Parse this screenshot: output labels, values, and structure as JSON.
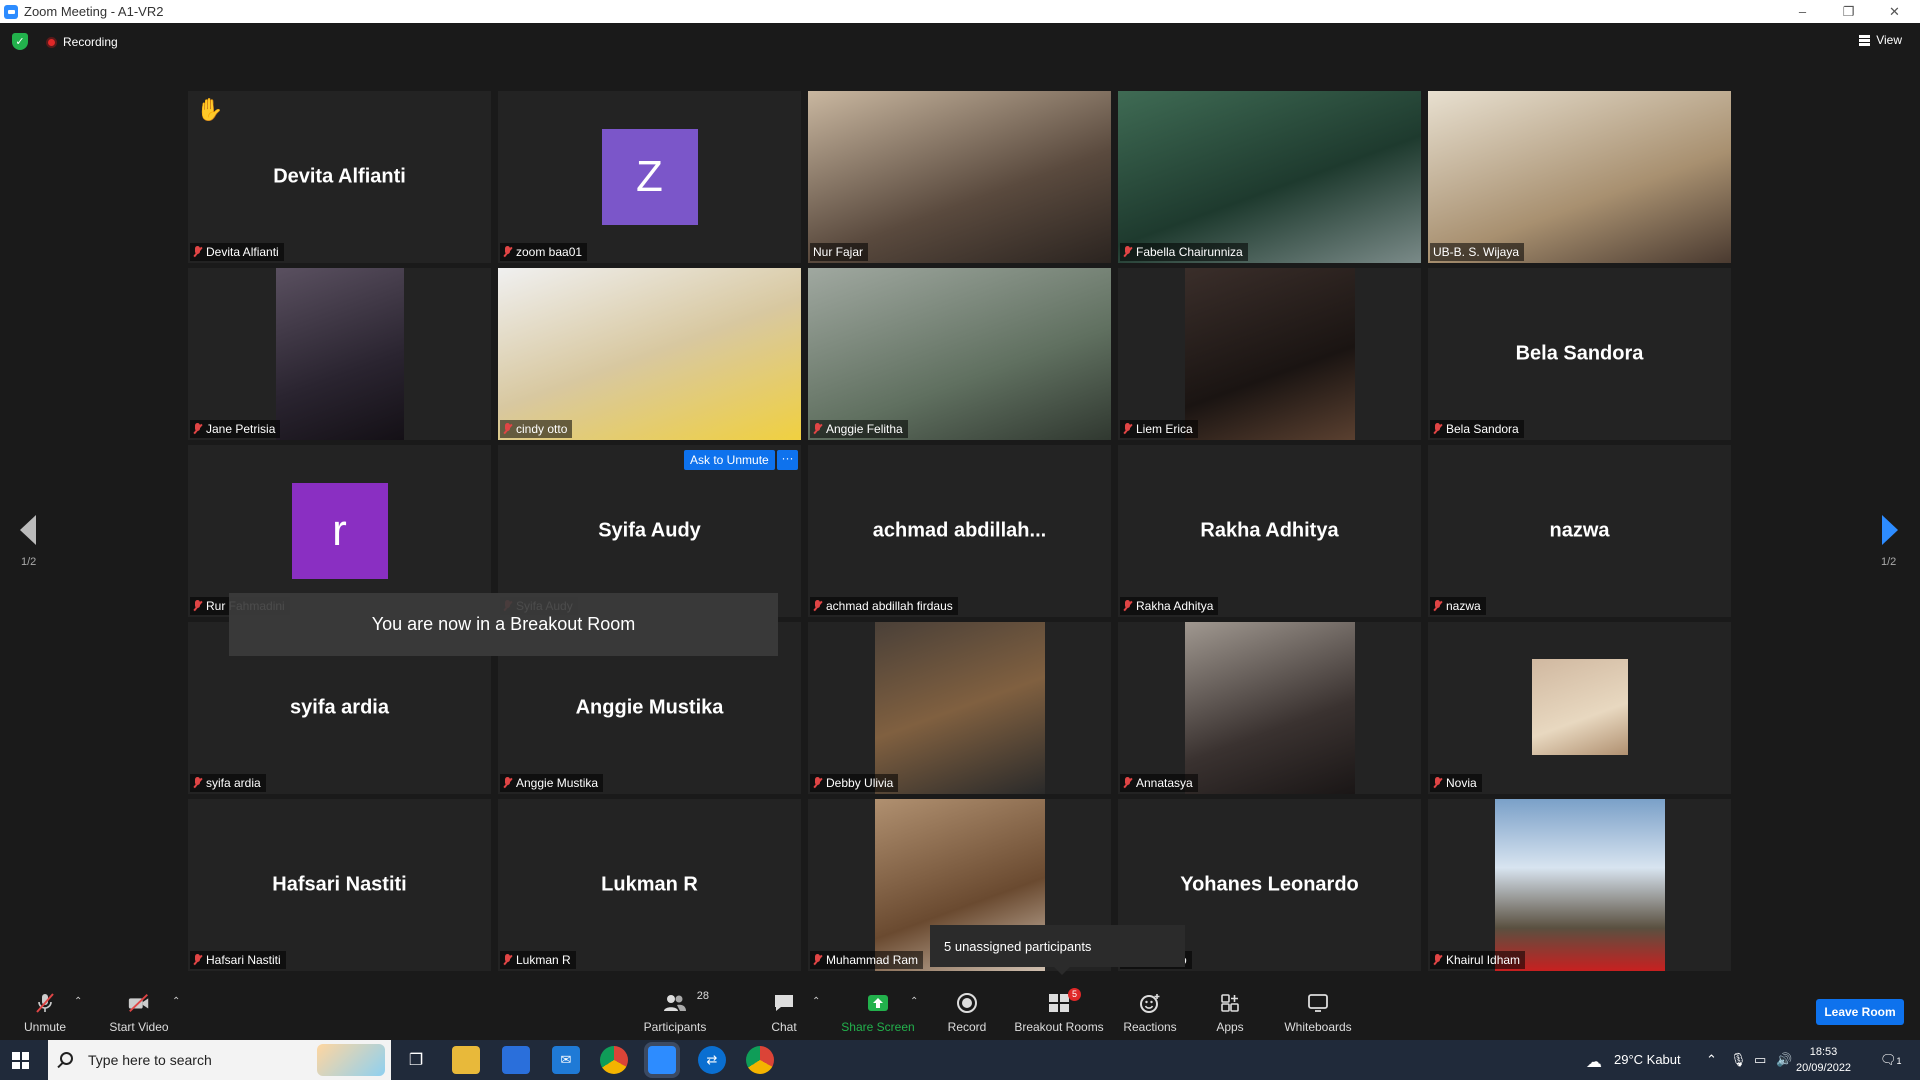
{
  "window": {
    "title": "Zoom Meeting - A1-VR2",
    "controls": [
      "–",
      "❐",
      "✕"
    ]
  },
  "topbar": {
    "recording_label": "Recording",
    "view_label": "View"
  },
  "tiles": [
    {
      "name": "Devita Alfianti",
      "label": "Devita Alfianti",
      "display": "name",
      "hand": "✋"
    },
    {
      "name": "zoom baa01",
      "label": "zoom baa01",
      "display": "avatar",
      "initial": "Z",
      "color": "#7b56c9"
    },
    {
      "name": "Nur Fajar",
      "label": "Nur Fajar",
      "display": "video",
      "active": true,
      "muted": false
    },
    {
      "name": "Fabella Chairunniza",
      "label": "Fabella Chairunniza",
      "display": "video"
    },
    {
      "name": "UB-B. S. Wijaya",
      "label": "UB-B. S. Wijaya",
      "display": "video",
      "muted": false
    },
    {
      "name": "Jane Petrisia",
      "label": "Jane Petrisia",
      "display": "video"
    },
    {
      "name": "cindy otto",
      "label": "cindy otto",
      "display": "video"
    },
    {
      "name": "Anggie Felitha",
      "label": "Anggie Felitha",
      "display": "video"
    },
    {
      "name": "Liem Erica",
      "label": "Liem Erica",
      "display": "video"
    },
    {
      "name": "Bela Sandora",
      "label": "Bela Sandora",
      "display": "name"
    },
    {
      "name": "Rur Fahmadini",
      "label": "Rur Fahmadini",
      "display": "avatar",
      "initial": "r",
      "color": "#8a2fc2"
    },
    {
      "name": "Syifa Audy",
      "label": "Syifa Audy",
      "display": "name"
    },
    {
      "name": "achmad  abdillah...",
      "label": "achmad abdillah firdaus",
      "display": "name"
    },
    {
      "name": "Rakha Adhitya",
      "label": "Rakha Adhitya",
      "display": "name"
    },
    {
      "name": "nazwa",
      "label": "nazwa",
      "display": "name"
    },
    {
      "name": "syifa ardia",
      "label": "syifa ardia",
      "display": "name"
    },
    {
      "name": "Anggie Mustika",
      "label": "Anggie Mustika",
      "display": "name"
    },
    {
      "name": "Debby Ulivia",
      "label": "Debby Ulivia",
      "display": "video"
    },
    {
      "name": "Annatasya",
      "label": "Annatasya",
      "display": "video"
    },
    {
      "name": "Novia",
      "label": "Novia",
      "display": "video"
    },
    {
      "name": "Hafsari Nastiti",
      "label": "Hafsari Nastiti",
      "display": "name"
    },
    {
      "name": "Lukman R",
      "label": "Lukman R",
      "display": "name"
    },
    {
      "name": "Muhammad Ram",
      "label": "Muhammad Ram",
      "display": "video"
    },
    {
      "name": "Yohanes Leonardo",
      "label": "Leonardo",
      "display": "name"
    },
    {
      "name": "Khairul Idham",
      "label": "Khairul Idham",
      "display": "video"
    }
  ],
  "page_indicator": {
    "left": "1/2",
    "right": "1/2"
  },
  "ask_to_unmute": {
    "label": "Ask to Unmute",
    "more": "···"
  },
  "toast": "You are now in a Breakout Room",
  "unassigned_tooltip": "5 unassigned participants",
  "toolbar": {
    "unmute": "Unmute",
    "start_video": "Start Video",
    "participants": "Participants",
    "participants_count": "28",
    "chat": "Chat",
    "share_screen": "Share Screen",
    "record": "Record",
    "breakout_rooms": "Breakout Rooms",
    "breakout_badge": "5",
    "reactions": "Reactions",
    "apps": "Apps",
    "whiteboards": "Whiteboards",
    "leave": "Leave Room"
  },
  "taskbar": {
    "search_placeholder": "Type here to search",
    "weather": "29°C  Kabut",
    "time": "18:53",
    "date": "20/09/2022",
    "notifications": "1"
  },
  "colors": {
    "accent": "#0e72ed",
    "active_speaker": "#c8e650",
    "share_green": "#22b14c",
    "muted_red": "#e04545"
  }
}
